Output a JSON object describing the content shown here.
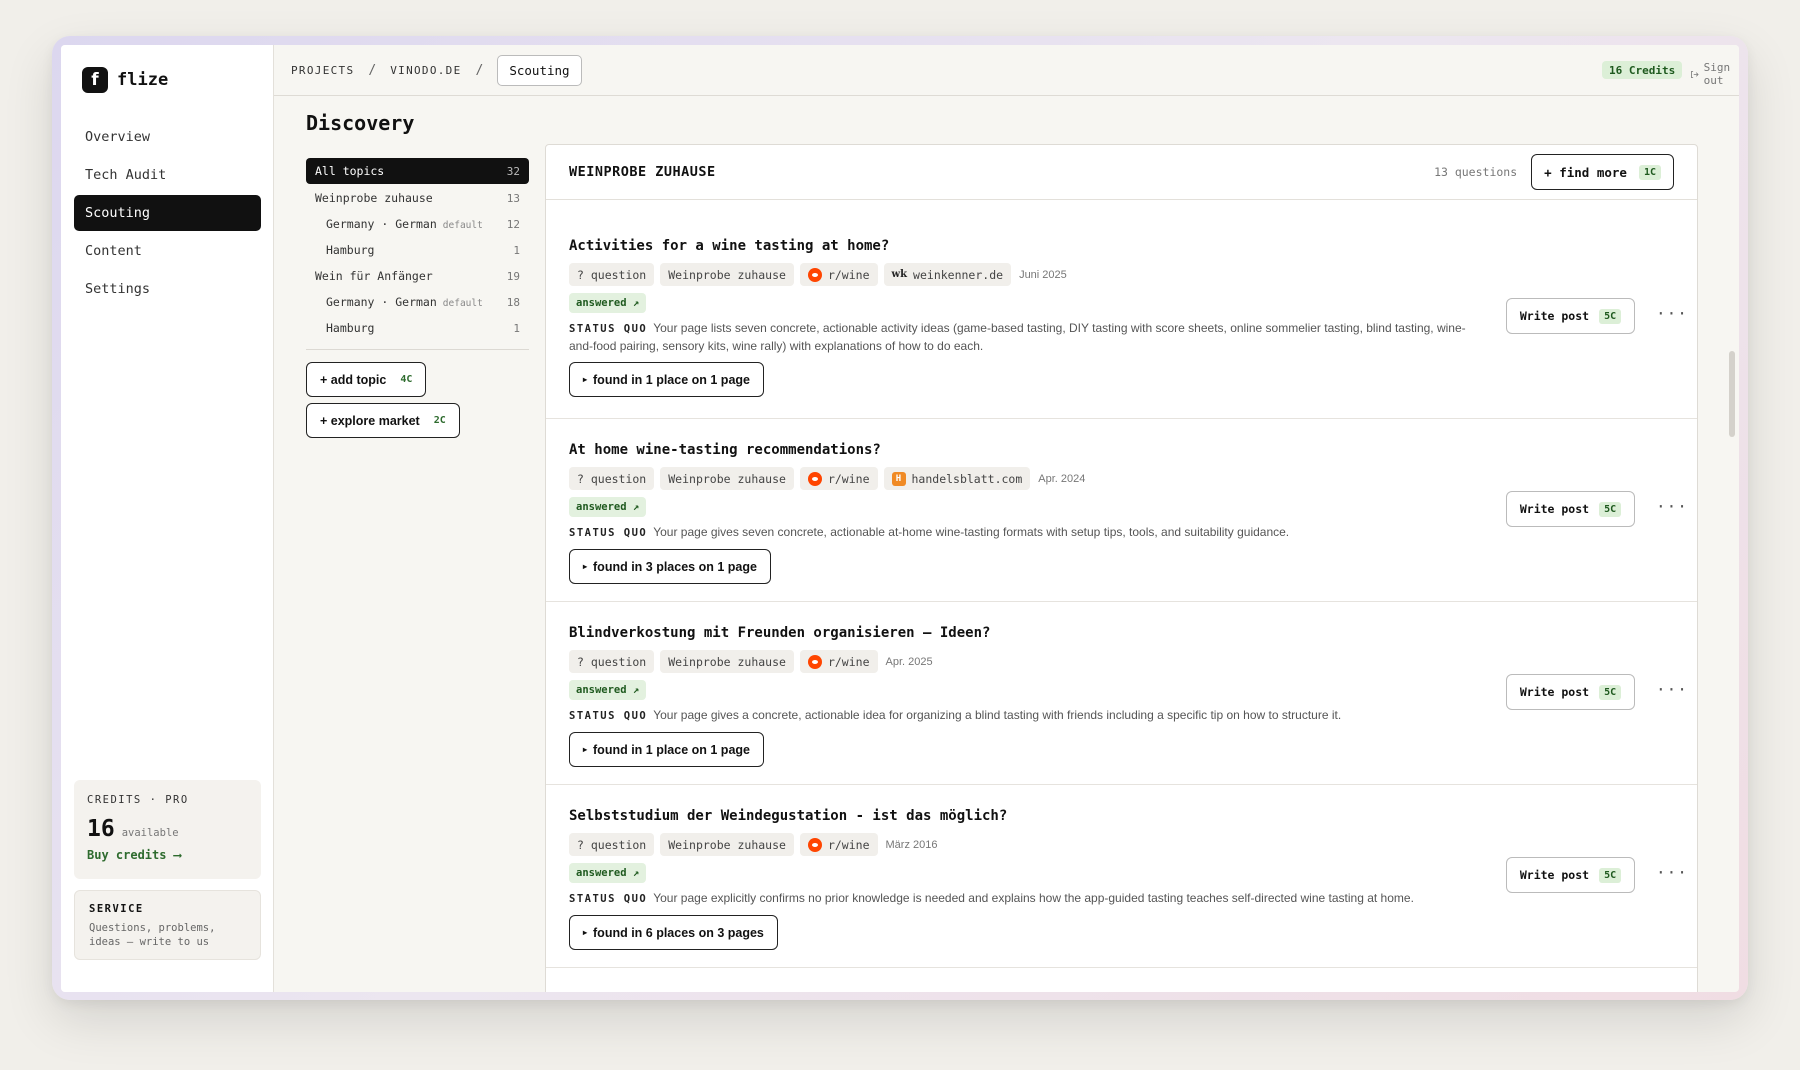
{
  "app": {
    "logo_letter": "f",
    "name": "flize"
  },
  "sidebar": {
    "nav": [
      {
        "label": "Overview"
      },
      {
        "label": "Tech Audit"
      },
      {
        "label": "Scouting",
        "active": true
      },
      {
        "label": "Content"
      },
      {
        "label": "Settings"
      }
    ],
    "credits": {
      "label": "CREDITS · PRO",
      "amount": "16",
      "available_label": "available",
      "buy_label": "Buy credits ⟶"
    },
    "service": {
      "title": "SERVICE",
      "text": "Questions, problems, ideas — write to us"
    }
  },
  "topbar": {
    "crumbs": [
      "PROJECTS",
      "VINODO.DE"
    ],
    "separator": "/",
    "current": "Scouting",
    "credits_pill": "16 Credits",
    "sign_out": "Sign out"
  },
  "page": {
    "title": "Discovery"
  },
  "topics": {
    "all": {
      "label": "All topics",
      "count": "32"
    },
    "items": [
      {
        "label": "Weinprobe zuhause",
        "count": "13",
        "sub": false
      },
      {
        "label": "Germany · German",
        "default": "default",
        "count": "12",
        "sub": true
      },
      {
        "label": "Hamburg",
        "count": "1",
        "sub": true
      },
      {
        "label": "Wein für Anfänger",
        "count": "19",
        "sub": false
      },
      {
        "label": "Germany · German",
        "default": "default",
        "count": "18",
        "sub": true
      },
      {
        "label": "Hamburg",
        "count": "1",
        "sub": true
      }
    ],
    "add_topic": {
      "label": "+ add topic",
      "cost": "4C"
    },
    "explore_market": {
      "label": "+ explore market",
      "cost": "2C"
    }
  },
  "panel": {
    "title": "WEINPROBE ZUHAUSE",
    "question_count": "13 questions",
    "find_more": {
      "label": "+ find more",
      "cost": "1C"
    },
    "write_label": "Write post",
    "write_cost": "5C",
    "more": "···",
    "status_label": "STATUS QUO",
    "answered_label": "answered ↗",
    "type_tag": "? question",
    "questions": [
      {
        "title": "Activities for a wine tasting at home?",
        "topic": "Weinprobe zuhause",
        "sources": [
          {
            "icon": "reddit",
            "label": "r/wine"
          },
          {
            "icon": "wk",
            "mark": "wk",
            "label": "weinkenner.de"
          }
        ],
        "date": "Juni 2025",
        "status": "Your page lists seven concrete, actionable activity ideas (game-based tasting, DIY tasting with score sheets, online sommelier tasting, blind tasting, wine-and-food pairing, sensory kits, wine rally) with explanations of how to do each.",
        "found": "found in 1 place on 1 page"
      },
      {
        "title": "At home wine-tasting recommendations?",
        "topic": "Weinprobe zuhause",
        "sources": [
          {
            "icon": "reddit",
            "label": "r/wine"
          },
          {
            "icon": "hb",
            "mark": "H",
            "label": "handelsblatt.com"
          }
        ],
        "date": "Apr. 2024",
        "status": "Your page gives seven concrete, actionable at-home wine-tasting formats with setup tips, tools, and suitability guidance.",
        "found": "found in 3 places on 1 page"
      },
      {
        "title": "Blindverkostung mit Freunden organisieren – Ideen?",
        "topic": "Weinprobe zuhause",
        "sources": [
          {
            "icon": "reddit",
            "label": "r/wine"
          }
        ],
        "date": "Apr. 2025",
        "status": "Your page gives a concrete, actionable idea for organizing a blind tasting with friends including a specific tip on how to structure it.",
        "found": "found in 1 place on 1 page"
      },
      {
        "title": "Selbststudium der Weindegustation - ist das möglich?",
        "topic": "Weinprobe zuhause",
        "sources": [
          {
            "icon": "reddit",
            "label": "r/wine"
          }
        ],
        "date": "März 2016",
        "status": "Your page explicitly confirms no prior knowledge is needed and explains how the app-guided tasting teaches self-directed wine tasting at home.",
        "found": "found in 6 places on 3 pages"
      }
    ]
  }
}
